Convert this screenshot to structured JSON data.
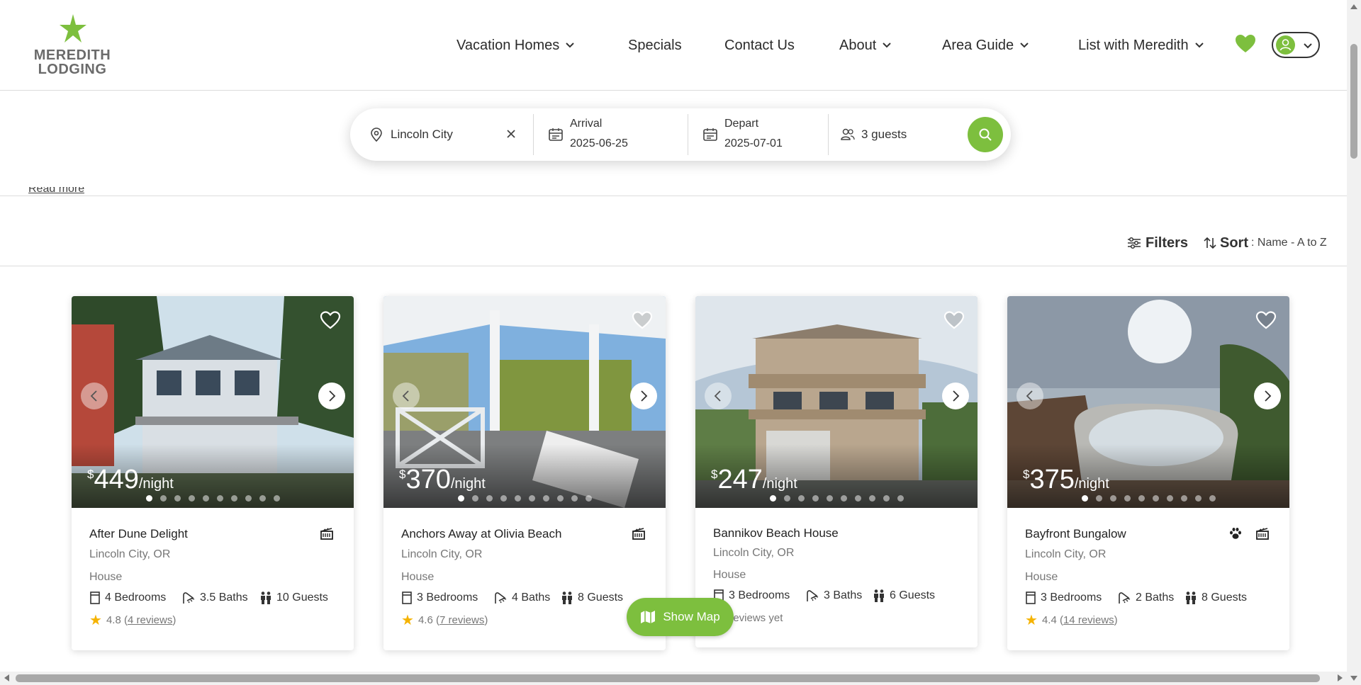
{
  "brand": {
    "line1": "MEREDITH",
    "line2": "LODGING",
    "accent_color": "#7dbf3e"
  },
  "nav": {
    "items": [
      {
        "label": "Vacation Homes",
        "has_dropdown": true
      },
      {
        "label": "Specials",
        "has_dropdown": false
      },
      {
        "label": "Contact Us",
        "has_dropdown": false
      },
      {
        "label": "About",
        "has_dropdown": true
      },
      {
        "label": "Area Guide",
        "has_dropdown": true
      },
      {
        "label": "List with Meredith",
        "has_dropdown": true
      }
    ],
    "favorites_icon": "heart-icon",
    "account_icon": "user-icon"
  },
  "search": {
    "location": "Lincoln City",
    "arrival_label": "Arrival",
    "arrival_value": "2025-06-25",
    "depart_label": "Depart",
    "depart_value": "2025-07-01",
    "guests": "3 guests"
  },
  "read_more": "Read more",
  "toolbar": {
    "filters_label": "Filters",
    "sort_label": "Sort",
    "sort_value": ": Name - A to Z"
  },
  "listings": [
    {
      "price_currency": "$",
      "price": "449",
      "price_unit": "/night",
      "title": "After Dune Delight",
      "location": "Lincoln City, OR",
      "type": "House",
      "bedrooms": "4 Bedrooms",
      "baths": "3.5 Baths",
      "guests": "10 Guests",
      "rating": "4.8",
      "reviews_prefix": "(",
      "reviews": "4 reviews",
      "reviews_suffix": ")",
      "badges": [
        "movie-icon"
      ]
    },
    {
      "price_currency": "$",
      "price": "370",
      "price_unit": "/night",
      "title": "Anchors Away at Olivia Beach",
      "location": "Lincoln City, OR",
      "type": "House",
      "bedrooms": "3 Bedrooms",
      "baths": "4 Baths",
      "guests": "8 Guests",
      "rating": "4.6",
      "reviews_prefix": "(",
      "reviews": "7 reviews",
      "reviews_suffix": ")",
      "badges": [
        "movie-icon"
      ]
    },
    {
      "price_currency": "$",
      "price": "247",
      "price_unit": "/night",
      "title": "Bannikov Beach House",
      "location": "Lincoln City, OR",
      "type": "House",
      "bedrooms": "3 Bedrooms",
      "baths": "3 Baths",
      "guests": "6 Guests",
      "no_reviews": "No reviews yet",
      "badges": []
    },
    {
      "price_currency": "$",
      "price": "375",
      "price_unit": "/night",
      "title": "Bayfront Bungalow",
      "location": "Lincoln City, OR",
      "type": "House",
      "bedrooms": "3 Bedrooms",
      "baths": "2 Baths",
      "guests": "8 Guests",
      "rating": "4.4",
      "reviews_prefix": "(",
      "reviews": "14 reviews",
      "reviews_suffix": ")",
      "badges": [
        "paw-icon",
        "movie-icon"
      ]
    }
  ],
  "map_button": {
    "label": "Show Map"
  }
}
